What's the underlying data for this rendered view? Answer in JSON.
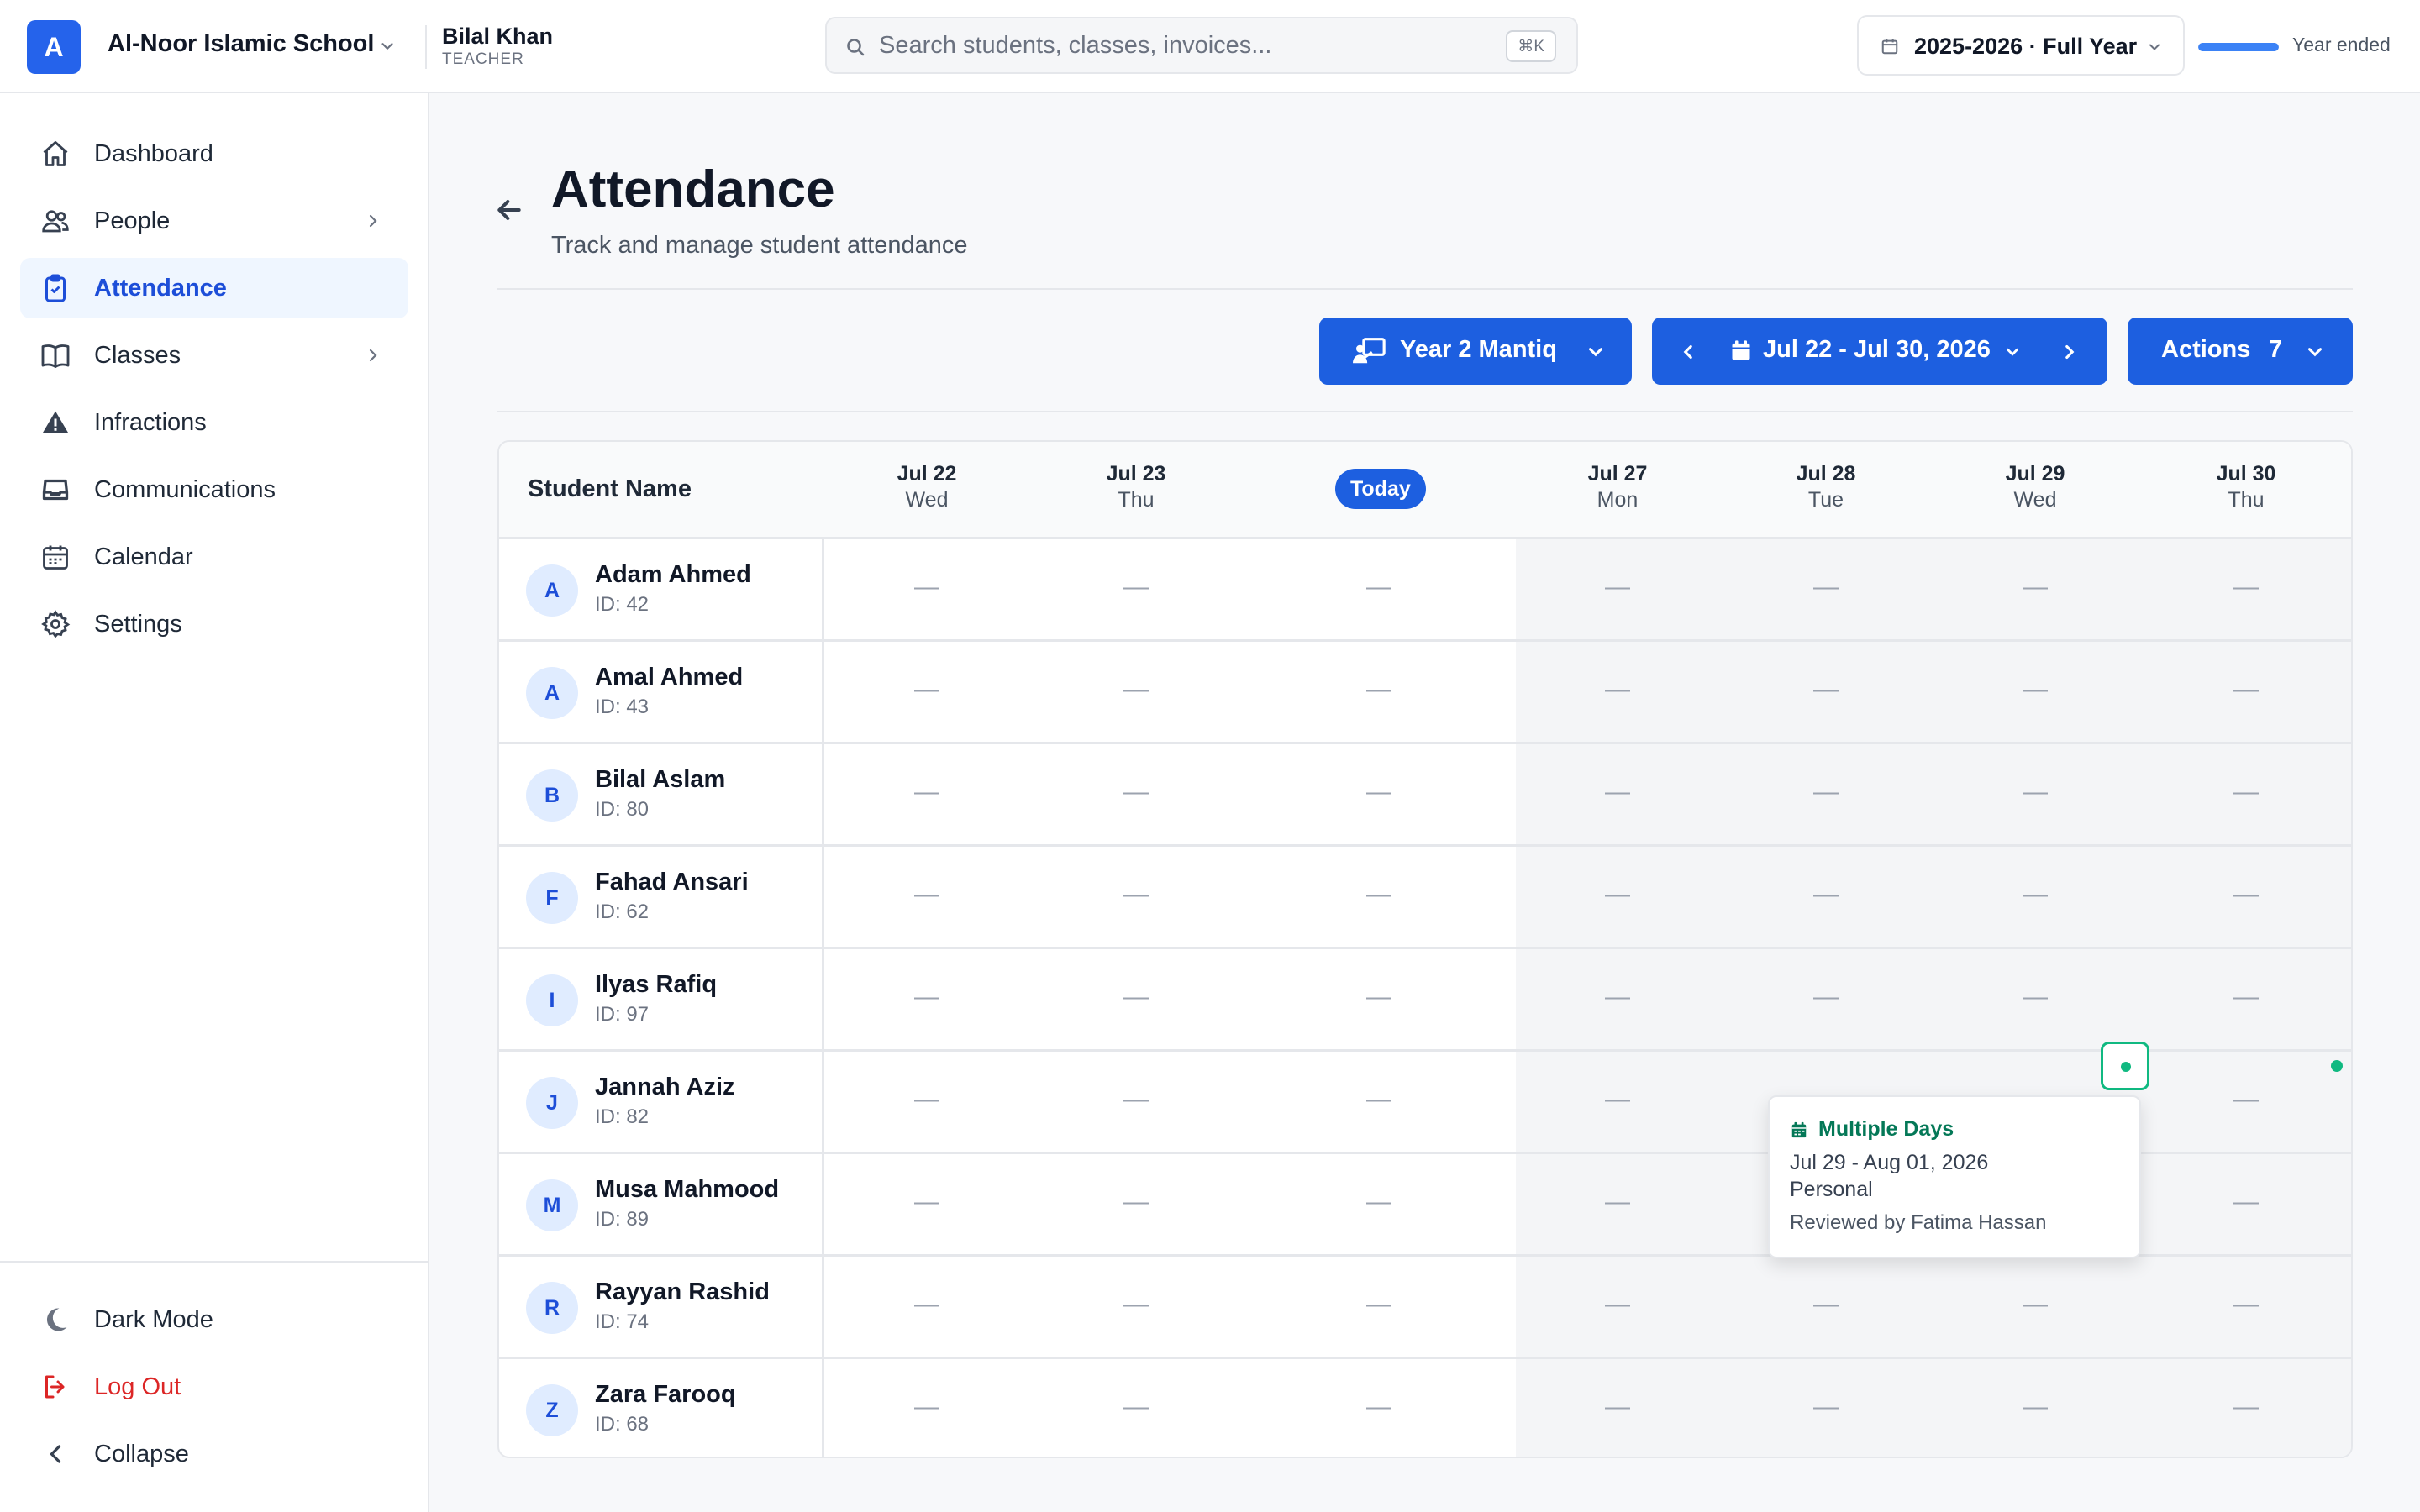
{
  "header": {
    "logo_letter": "A",
    "school_name": "Al-Noor Islamic School",
    "user_name": "Bilal Khan",
    "user_role": "TEACHER",
    "search_placeholder": "Search students, classes, invoices...",
    "search_shortcut": "⌘K",
    "year_label": "2025-2026 · Full Year",
    "year_progress_pct": 100,
    "year_status": "Year ended"
  },
  "sidebar": {
    "items": [
      {
        "label": "Dashboard",
        "icon": "home-icon"
      },
      {
        "label": "People",
        "icon": "users-icon",
        "has_submenu": true
      },
      {
        "label": "Attendance",
        "icon": "clipboard-check-icon",
        "active": true
      },
      {
        "label": "Classes",
        "icon": "book-icon",
        "has_submenu": true
      },
      {
        "label": "Infractions",
        "icon": "warning-icon"
      },
      {
        "label": "Communications",
        "icon": "inbox-icon"
      },
      {
        "label": "Calendar",
        "icon": "calendar-icon"
      },
      {
        "label": "Settings",
        "icon": "gear-icon"
      }
    ],
    "footer": [
      {
        "label": "Dark Mode",
        "icon": "moon-icon"
      },
      {
        "label": "Log Out",
        "icon": "logout-icon"
      },
      {
        "label": "Collapse",
        "icon": "chevron-left-icon"
      }
    ]
  },
  "page": {
    "title": "Attendance",
    "subtitle": "Track and manage student attendance"
  },
  "toolbar": {
    "class_label": "Year 2 Mantiq",
    "date_range": "Jul 22 - Jul 30, 2026",
    "actions_label": "Actions",
    "actions_count": "7"
  },
  "table": {
    "student_header": "Student Name",
    "columns": [
      {
        "day": "Jul 22",
        "weekday": "Wed"
      },
      {
        "day": "Jul 23",
        "weekday": "Thu"
      },
      {
        "today": "Today"
      },
      {
        "day": "Jul 27",
        "weekday": "Mon"
      },
      {
        "day": "Jul 28",
        "weekday": "Tue"
      },
      {
        "day": "Jul 29",
        "weekday": "Wed"
      },
      {
        "day": "Jul 30",
        "weekday": "Thu"
      }
    ],
    "empty_mark": "—",
    "students": [
      {
        "initial": "A",
        "name": "Adam Ahmed",
        "id": "ID: 42"
      },
      {
        "initial": "A",
        "name": "Amal Ahmed",
        "id": "ID: 43"
      },
      {
        "initial": "B",
        "name": "Bilal Aslam",
        "id": "ID: 80"
      },
      {
        "initial": "F",
        "name": "Fahad Ansari",
        "id": "ID: 62"
      },
      {
        "initial": "I",
        "name": "Ilyas Rafiq",
        "id": "ID: 97"
      },
      {
        "initial": "J",
        "name": "Jannah Aziz",
        "id": "ID: 82"
      },
      {
        "initial": "M",
        "name": "Musa Mahmood",
        "id": "ID: 89"
      },
      {
        "initial": "R",
        "name": "Rayyan Rashid",
        "id": "ID: 74"
      },
      {
        "initial": "Z",
        "name": "Zara Farooq",
        "id": "ID: 68"
      }
    ]
  },
  "tooltip": {
    "title": "Multiple Days",
    "range": "Jul 29 - Aug 01, 2026",
    "type": "Personal",
    "reviewed": "Reviewed by Fatima Hassan"
  },
  "colors": {
    "primary": "#1d5fe0",
    "accent_green": "#10b981",
    "danger": "#dc2626"
  }
}
